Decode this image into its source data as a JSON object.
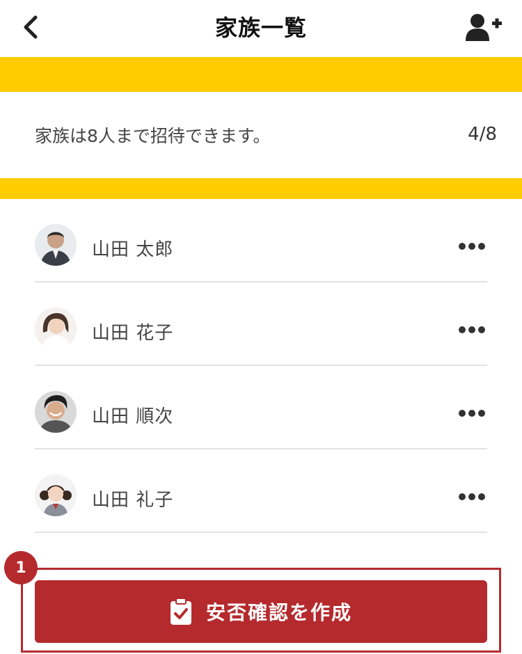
{
  "header": {
    "title": "家族一覧",
    "back_icon": "chevron-left-icon",
    "add_icon": "user-plus-icon"
  },
  "info": {
    "text": "家族は8人まで招待できます。",
    "count": "4/8"
  },
  "members": [
    {
      "name": "山田 太郎",
      "avatar": "avatar-photo",
      "more_icon": "more-horizontal-icon"
    },
    {
      "name": "山田 花子",
      "avatar": "avatar-photo",
      "more_icon": "more-horizontal-icon"
    },
    {
      "name": "山田 順次",
      "avatar": "avatar-photo",
      "more_icon": "more-horizontal-icon"
    },
    {
      "name": "山田 礼子",
      "avatar": "avatar-photo",
      "more_icon": "more-horizontal-icon"
    }
  ],
  "annotation": {
    "step": "1"
  },
  "action": {
    "label": "安否確認を作成",
    "icon": "clipboard-check-icon"
  },
  "colors": {
    "accent_yellow": "#FFCC00",
    "primary_red": "#B52A2D"
  }
}
